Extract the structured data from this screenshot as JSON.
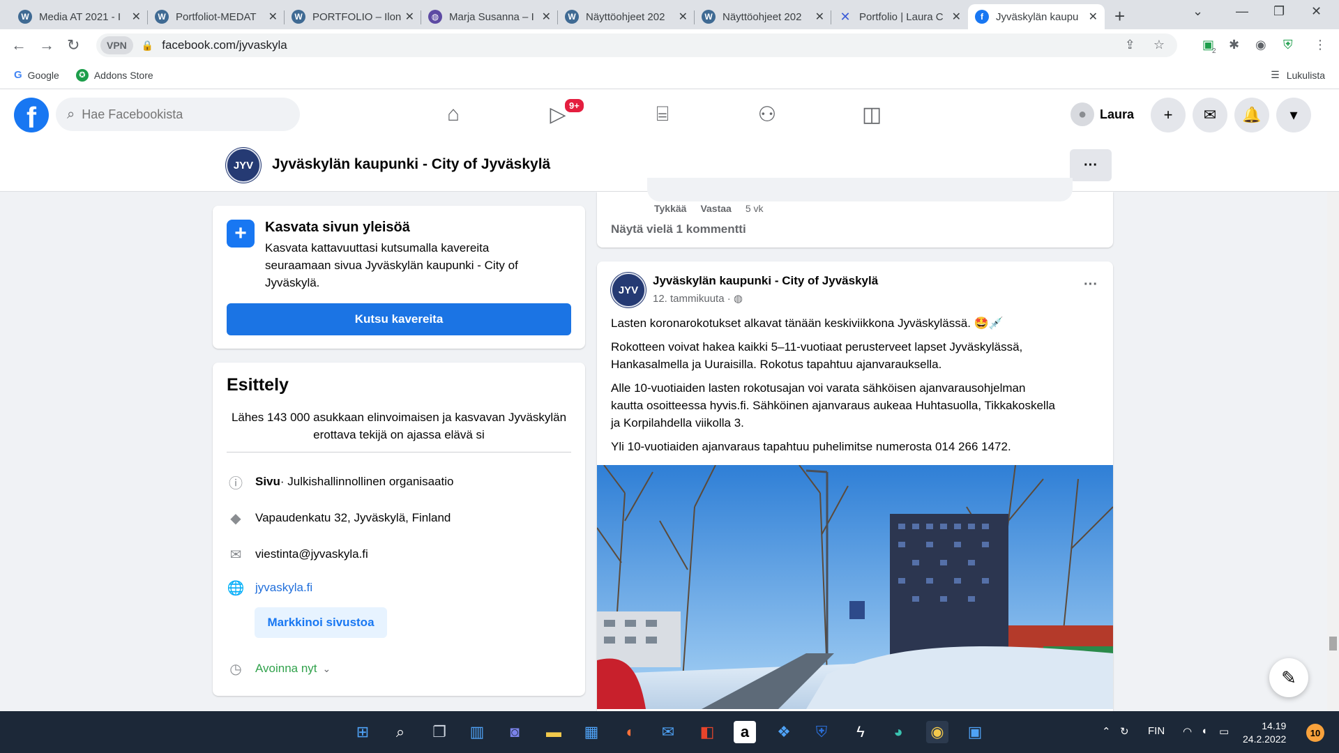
{
  "browser": {
    "tabs": [
      {
        "title": "Media AT 2021 - I",
        "icon": "wordpress-icon"
      },
      {
        "title": "Portfoliot-MEDAT",
        "icon": "wordpress-icon"
      },
      {
        "title": "PORTFOLIO – Ilon",
        "icon": "wordpress-icon"
      },
      {
        "title": "Marja Susanna – I",
        "icon": "globe-icon"
      },
      {
        "title": "Näyttöohjeet 202",
        "icon": "wordpress-icon"
      },
      {
        "title": "Näyttöohjeet 202",
        "icon": "wordpress-icon"
      },
      {
        "title": "Portfolio | Laura C",
        "icon": "x-logo-icon"
      },
      {
        "title": "Jyväskylän kaupu",
        "icon": "facebook-icon",
        "active": true
      }
    ],
    "vpn_label": "VPN",
    "url": "facebook.com/jyvaskyla",
    "bookmarks": [
      "Google",
      "Addons Store"
    ],
    "reading_list": "Lukulista",
    "ext_badge": "2"
  },
  "fb": {
    "search_placeholder": "Hae Facebookista",
    "watch_badge": "9+",
    "user_name": "Laura"
  },
  "page": {
    "avatar_text": "JYV",
    "name": "Jyväskylän kaupunki - City of Jyväskylä",
    "more_label": "···"
  },
  "grow_card": {
    "title": "Kasvata sivun yleisöä",
    "description": "Kasvata kattavuuttasi kutsumalla kavereita seuraamaan sivua Jyväskylän kaupunki - City of Jyväskylä.",
    "button": "Kutsu kavereita"
  },
  "intro": {
    "heading": "Esittely",
    "description": "Lähes 143 000 asukkaan elinvoimaisen ja kasvavan Jyväskylän erottava tekijä on ajassa elävä si",
    "page_type_label": "Sivu",
    "page_type_value": " · Julkishallinnollinen organisaatio",
    "address": "Vapaudenkatu 32, Jyväskylä, Finland",
    "email": "viestinta@jyvaskyla.fi",
    "website": "jyvaskyla.fi",
    "promote_button": "Markkinoi sivustoa",
    "hours": "Avoinna nyt"
  },
  "comment": {
    "like": "Tykkää",
    "reply": "Vastaa",
    "age": "5 vk",
    "more_comments": "Näytä vielä 1 kommentti"
  },
  "post": {
    "author": "Jyväskylän kaupunki - City of Jyväskylä",
    "date": "12. tammikuuta · ",
    "paragraphs": [
      "Lasten koronarokotukset alkavat tänään keskiviikkona Jyväskylässä. 🤩💉",
      "Rokotteen voivat hakea kaikki 5–11-vuotiaat perusterveet lapset Jyväskylässä, Hankasalmella ja Uuraisilla. Rokotus tapahtuu ajanvarauksella.",
      "Alle 10-vuotiaiden lasten rokotusajan voi varata sähköisen ajanvarausohjelman kautta osoitteessa hyvis.fi. Sähköinen ajanvaraus aukeaa Huhtasuolla, Tikkakoskella ja Korpilahdella viikolla 3.",
      "Yli 10-vuotiaiden ajanvaraus tapahtuu puhelimitse numerosta 014 266 1472."
    ]
  },
  "taskbar": {
    "language": "FIN",
    "time": "14.19",
    "date": "24.2.2022",
    "notifications": "10"
  }
}
